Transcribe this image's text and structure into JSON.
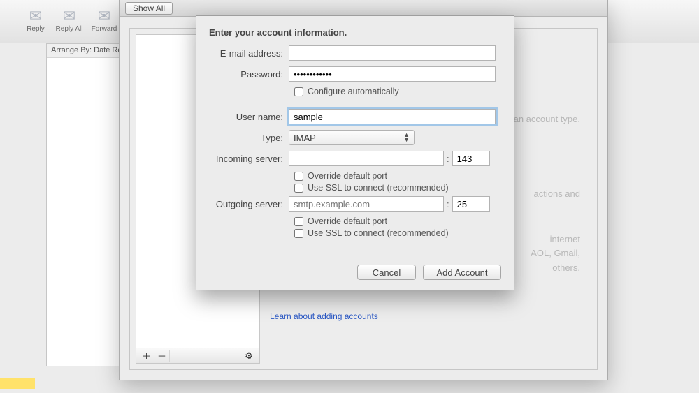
{
  "toolbar": {
    "reply": "Reply",
    "replyAll": "Reply All",
    "forward": "Forward"
  },
  "sidebar": {
    "arrange": "Arrange By: Date Re"
  },
  "prefs": {
    "showAll": "Show All",
    "learnLink": "Learn about adding accounts",
    "bgHint1": "select an account type.",
    "bgHint2": "internet",
    "bgHint3": "AOL, Gmail,",
    "bgHint4": "others.",
    "bgHint5": "actions and"
  },
  "dialog": {
    "title": "Enter your account information.",
    "emailLabel": "E-mail address:",
    "emailValue": "",
    "passwordLabel": "Password:",
    "passwordValue": "••••••••••••",
    "configureAuto": "Configure automatically",
    "userLabel": "User name:",
    "userValue": "sample",
    "typeLabel": "Type:",
    "typeValue": "IMAP",
    "incomingLabel": "Incoming server:",
    "incomingValue": "",
    "incomingPort": "143",
    "outgoingLabel": "Outgoing server:",
    "outgoingPlaceholder": "smtp.example.com",
    "outgoingPort": "25",
    "overridePort": "Override default port",
    "useSSL": "Use SSL to connect (recommended)",
    "cancel": "Cancel",
    "addAccount": "Add Account"
  }
}
